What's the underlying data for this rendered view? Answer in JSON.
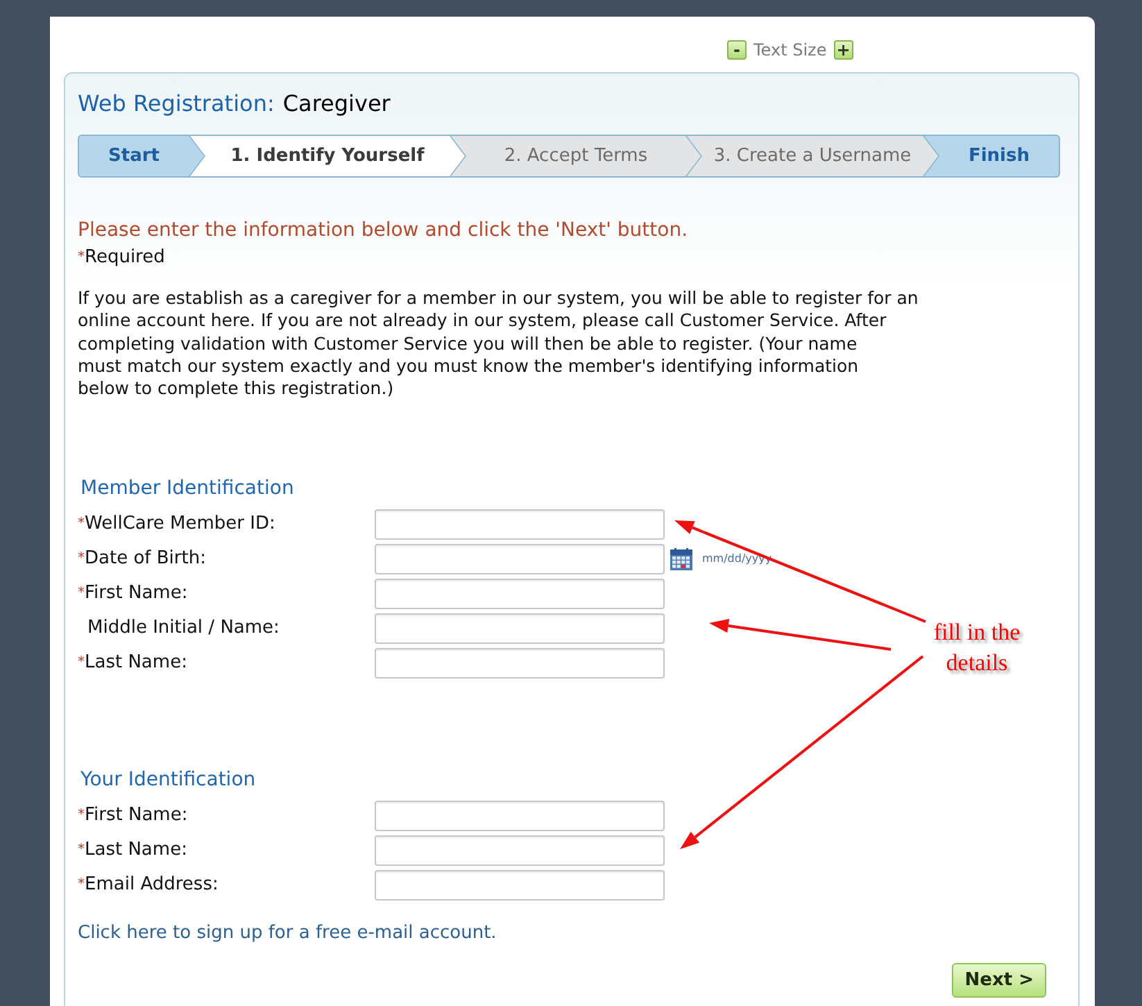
{
  "text_size": {
    "decrease": "-",
    "label": "Text Size",
    "increase": "+"
  },
  "registration": {
    "title": "Web Registration:",
    "subtitle": "Caregiver"
  },
  "steps": [
    {
      "label": "Start",
      "kind": "endpoint",
      "selected": false
    },
    {
      "label": "1. Identify Yourself",
      "kind": "step",
      "selected": true
    },
    {
      "label": "2. Accept Terms",
      "kind": "step",
      "selected": false
    },
    {
      "label": "3. Create a Username",
      "kind": "step",
      "selected": false
    },
    {
      "label": "Finish",
      "kind": "endpoint",
      "selected": false
    }
  ],
  "instruction": "Please enter the information below and click the 'Next' button.",
  "required_note": {
    "marker": "*",
    "text": "Required"
  },
  "intro_lines": [
    "If you are establish as a caregiver for a member in our system, you will be able to register for an",
    "online account here. If you are not already in our system, please call Customer Service. After",
    "completing validation with Customer Service you will then be able to register. (Your name",
    "must match our system exactly and you must know the member's identifying information",
    "below to complete this registration.)"
  ],
  "sections": [
    {
      "title": "Member Identification",
      "fields": [
        {
          "marker": "*",
          "label": "WellCare Member ID:"
        },
        {
          "marker": "*",
          "label": "Date of Birth:",
          "kind": "date",
          "hint": "mm/dd/yyyy"
        },
        {
          "marker": "*",
          "label": "First Name:"
        },
        {
          "label": "Middle Initial / Name:"
        },
        {
          "marker": "*",
          "label": "Last Name:"
        }
      ]
    },
    {
      "title": "Your Identification",
      "fields": [
        {
          "marker": "*",
          "label": "First Name:"
        },
        {
          "marker": "*",
          "label": "Last Name:"
        },
        {
          "marker": "*",
          "label": "Email Address:"
        }
      ]
    }
  ],
  "email_link": "Click here to sign up for a free e-mail account.",
  "next_button": "Next >",
  "annotation": {
    "lines": [
      "fill in the",
      "details"
    ]
  }
}
